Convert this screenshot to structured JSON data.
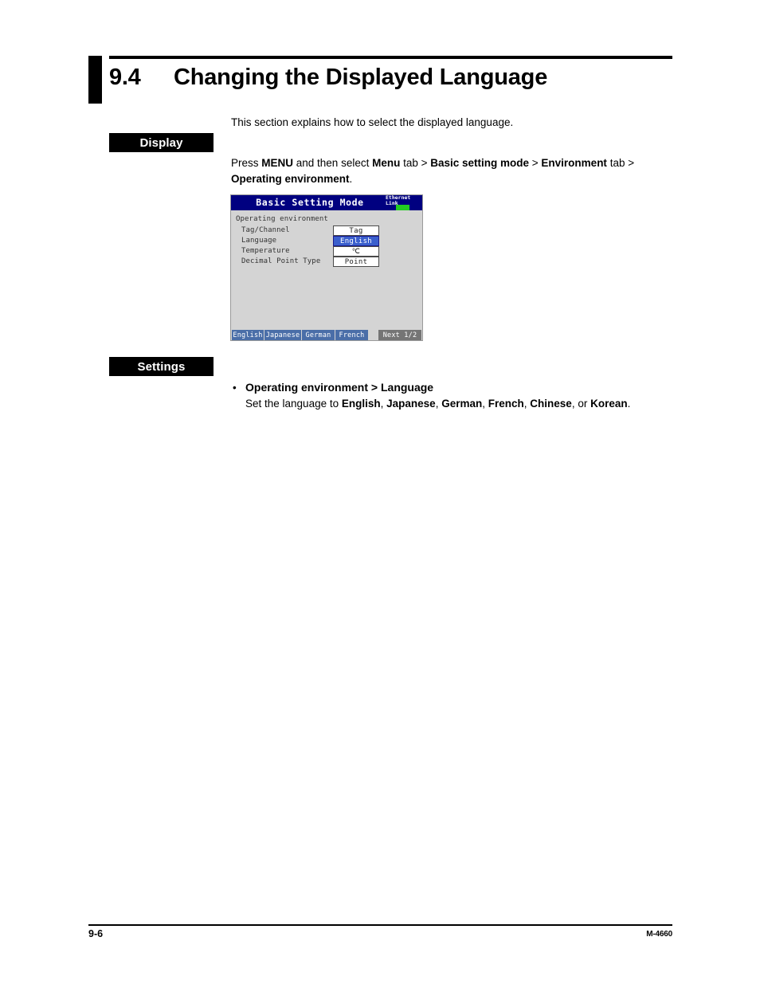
{
  "page": {
    "section_number": "9.4",
    "section_title": "Changing the Displayed Language",
    "intro": "This section explains how to select the displayed language."
  },
  "display_section": {
    "label": "Display",
    "procedure": {
      "p1_a": "Press ",
      "p1_menu_key": "MENU",
      "p1_b": " and then select ",
      "p1_menu_tab": "Menu",
      "p1_c": " tab > ",
      "p1_basic_mode": "Basic setting mode",
      "p1_d": " > ",
      "p1_environment": "Environment",
      "p1_e": " tab >",
      "p2_operating_env": "Operating environment",
      "p2_period": "."
    }
  },
  "lcd": {
    "title": "Basic Setting Mode",
    "ethernet_indicator": {
      "line1": "Ethernet",
      "line2": "Link",
      "led_color": "#22cc22"
    },
    "group_title": "Operating environment",
    "rows": [
      {
        "label": "Tag/Channel",
        "value": "Tag",
        "selected": false
      },
      {
        "label": "Language",
        "value": "English",
        "selected": true
      },
      {
        "label": "Temperature",
        "value": "℃",
        "selected": false
      },
      {
        "label": "Decimal Point Type",
        "value": "Point",
        "selected": false
      }
    ],
    "softkeys": [
      {
        "label": "English",
        "kind": "option"
      },
      {
        "label": "Japanese",
        "kind": "option"
      },
      {
        "label": "German",
        "kind": "option"
      },
      {
        "label": "French",
        "kind": "option"
      },
      {
        "label": "Next 1/2",
        "kind": "next"
      }
    ],
    "colors": {
      "titlebar": "#000080",
      "background": "#d4d4d4",
      "selected_row": "#3a5fcd",
      "softkey": "#4a6ea8",
      "softkey_next": "#757575"
    }
  },
  "settings_section": {
    "label": "Settings",
    "bullet_symbol": "•",
    "bullet_heading": "Operating environment > Language",
    "sub_a": "Set the language to ",
    "sub_opt1": "English",
    "sub_sep1": ", ",
    "sub_opt2": "Japanese",
    "sub_sep2": ", ",
    "sub_opt3": "German",
    "sub_sep3": ", ",
    "sub_opt4": "French",
    "sub_sep4": ", ",
    "sub_opt5": "Chinese",
    "sub_sep5": ", or ",
    "sub_opt6": "Korean",
    "sub_end": "."
  },
  "footer": {
    "page_number": "9-6",
    "document_code": "M-4660"
  }
}
